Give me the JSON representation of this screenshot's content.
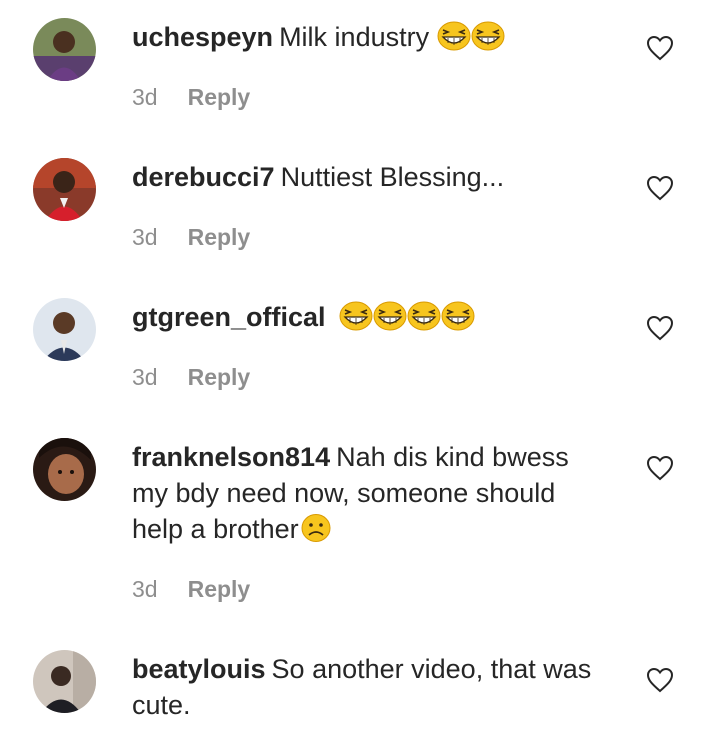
{
  "comments": [
    {
      "username": "uchespeyn",
      "text": "Milk industry",
      "emoji_count": 2,
      "emoji": "grinning-squint-face",
      "time": "3d",
      "reply_label": "Reply"
    },
    {
      "username": "derebucci7",
      "text": "Nuttiest Blessing...",
      "emoji_count": 0,
      "time": "3d",
      "reply_label": "Reply"
    },
    {
      "username": "gtgreen_offical",
      "text": "",
      "emoji_count": 4,
      "emoji": "grinning-squint-face",
      "time": "3d",
      "reply_label": "Reply"
    },
    {
      "username": "franknelson814",
      "text": "Nah dis kind bwess my bdy need now, someone should help a brother",
      "emoji_count": 1,
      "emoji": "sad-face",
      "time": "3d",
      "reply_label": "Reply"
    },
    {
      "username": "beatylouis",
      "text": "So another video, that was cute.",
      "emoji_count": 0
    }
  ],
  "icons": {
    "like": "heart-outline-icon"
  },
  "colors": {
    "text": "#262626",
    "meta": "#8e8e8e",
    "emoji_yellow": "#f7c51e"
  }
}
